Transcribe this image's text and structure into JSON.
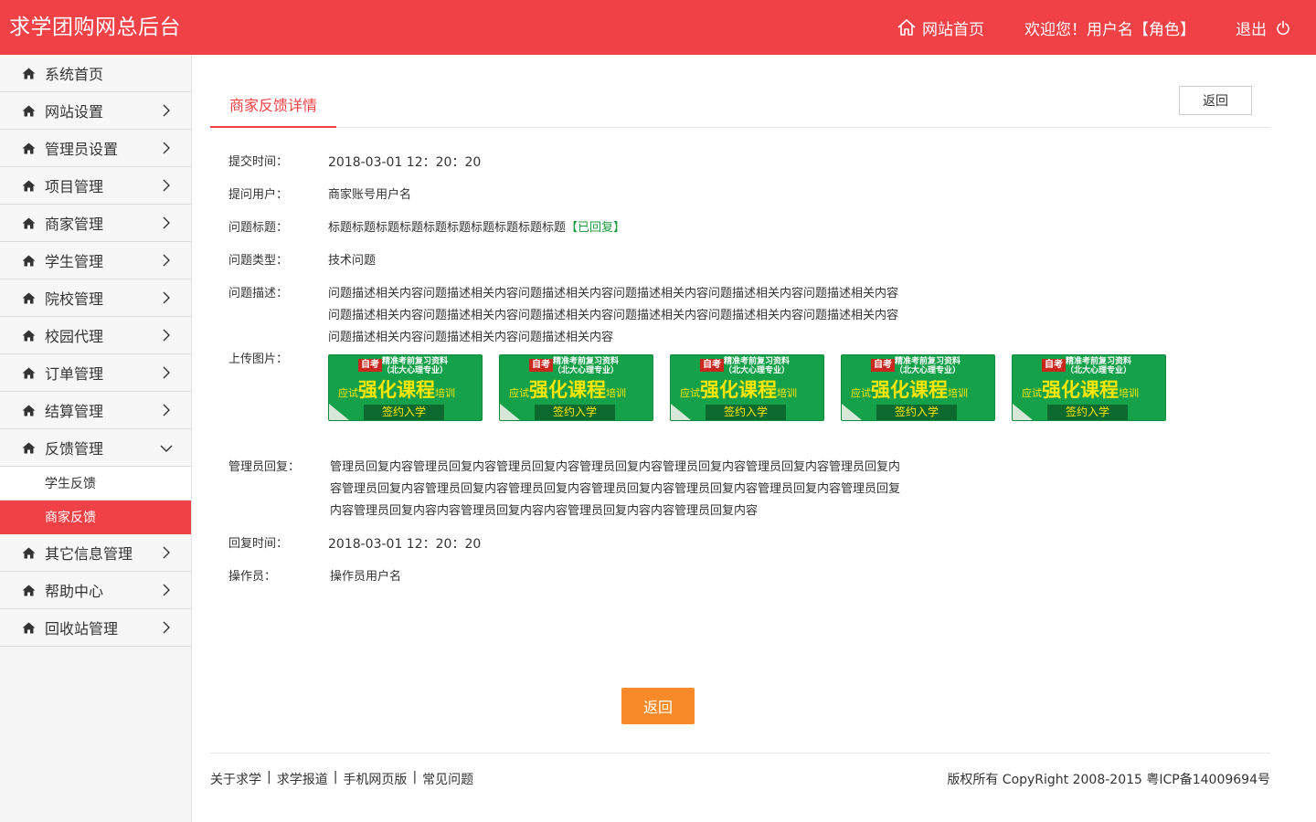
{
  "header": {
    "brand": "求学团购网总后台",
    "home_label": "网站首页",
    "welcome": "欢迎您！用户名【角色】",
    "logout": "退出"
  },
  "sidebar": {
    "items": [
      {
        "label": "系统首页"
      },
      {
        "label": "网站设置"
      },
      {
        "label": "管理员设置"
      },
      {
        "label": "项目管理"
      },
      {
        "label": "商家管理"
      },
      {
        "label": "学生管理"
      },
      {
        "label": "院校管理"
      },
      {
        "label": "校园代理"
      },
      {
        "label": "订单管理"
      },
      {
        "label": "结算管理"
      },
      {
        "label": "反馈管理"
      },
      {
        "label": "其它信息管理"
      },
      {
        "label": "帮助中心"
      },
      {
        "label": "回收站管理"
      }
    ],
    "sub_items": [
      {
        "label": "学生反馈"
      },
      {
        "label": "商家反馈"
      }
    ]
  },
  "main": {
    "tab": "商家反馈详情",
    "back_top": "返回",
    "back_bottom": "返回",
    "fields": {
      "submit_time_label": "提交时间：",
      "submit_time": "2018-03-01 12：20：20",
      "user_label": "提问用户：",
      "user": "商家账号用户名",
      "title_label": "问题标题：",
      "title": "标题标题标题标题标题标题标题标题标题标题",
      "title_status": "【已回复】",
      "type_label": "问题类型：",
      "type": "技术问题",
      "desc_label": "问题描述：",
      "desc_line1": "问题描述相关内容问题描述相关内容问题描述相关内容问题描述相关内容问题描述相关内容问题描述相关内容",
      "desc_line2": "问题描述相关内容问题描述相关内容问题描述相关内容问题描述相关内容问题描述相关内容问题描述相关内容",
      "desc_line3": "问题描述相关内容问题描述相关内容问题描述相关内容",
      "images_label": "上传图片：",
      "reply_label": "管理员回复：",
      "reply_line1": "管理员回复内容管理员回复内容管理员回复内容管理员回复内容管理员回复内容管理员回复内容管理员回复内",
      "reply_line2": "容管理员回复内容管理员回复内容管理员回复内容管理员回复内容管理员回复内容管理员回复内容管理员回复",
      "reply_line3": "内容管理员回复内容内容管理员回复内容内容管理员回复内容内容管理员回复内容",
      "reply_time_label": "回复时间：",
      "reply_time": "2018-03-01 12：20：20",
      "operator_label": "操作员：",
      "operator": "操作员用户名"
    },
    "ad": {
      "badge": "自考",
      "top1": "精准考前复习资料",
      "top2": "（北大心理专业）",
      "small1": "应试",
      "big": "强化课程",
      "small2": "培训",
      "bottom": "签约入学"
    }
  },
  "footer": {
    "links": [
      "关于求学",
      "求学报道",
      "手机网页版",
      "常见问题"
    ],
    "separator": "|",
    "copyright": "版权所有 CopyRight 2008-2015 粤ICP备14009694号"
  },
  "colors": {
    "brand_red": "#ef4146",
    "accent_orange": "#f98a2a",
    "replied_green": "#1a9b3d"
  }
}
